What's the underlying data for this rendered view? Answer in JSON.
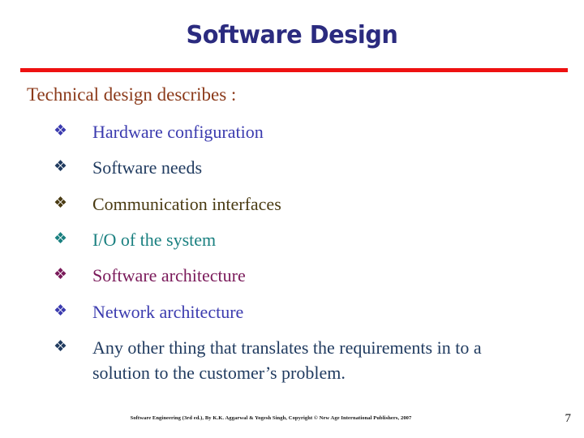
{
  "slide": {
    "title": "Software Design",
    "title_color": "#2b2b7f",
    "rule_color": "#ee1111",
    "background": "#ffffff",
    "intro": "Technical design describes :",
    "intro_color": "#8b3a1a",
    "bullet_glyph": "❖",
    "bullets": [
      {
        "text": "Hardware configuration",
        "color": "#3b3baf"
      },
      {
        "text": "Software needs",
        "color": "#1f3a5f"
      },
      {
        "text": "Communication interfaces",
        "color": "#4a3b13"
      },
      {
        "text": "I/O of the system",
        "color": "#1a8080"
      },
      {
        "text": "Software architecture",
        "color": "#7a1a5a"
      },
      {
        "text": "Network architecture",
        "color": "#3b3baf"
      },
      {
        "text": "Any other thing that translates the requirements in to a solution to the customer’s problem.",
        "color": "#1f3a5f"
      }
    ],
    "footer": {
      "citation": "Software Engineering (3rd ed.), By K.K. Aggarwal & Yogesh Singh, Copyright © New Age International Publishers, 2007",
      "page_number": "7"
    }
  }
}
